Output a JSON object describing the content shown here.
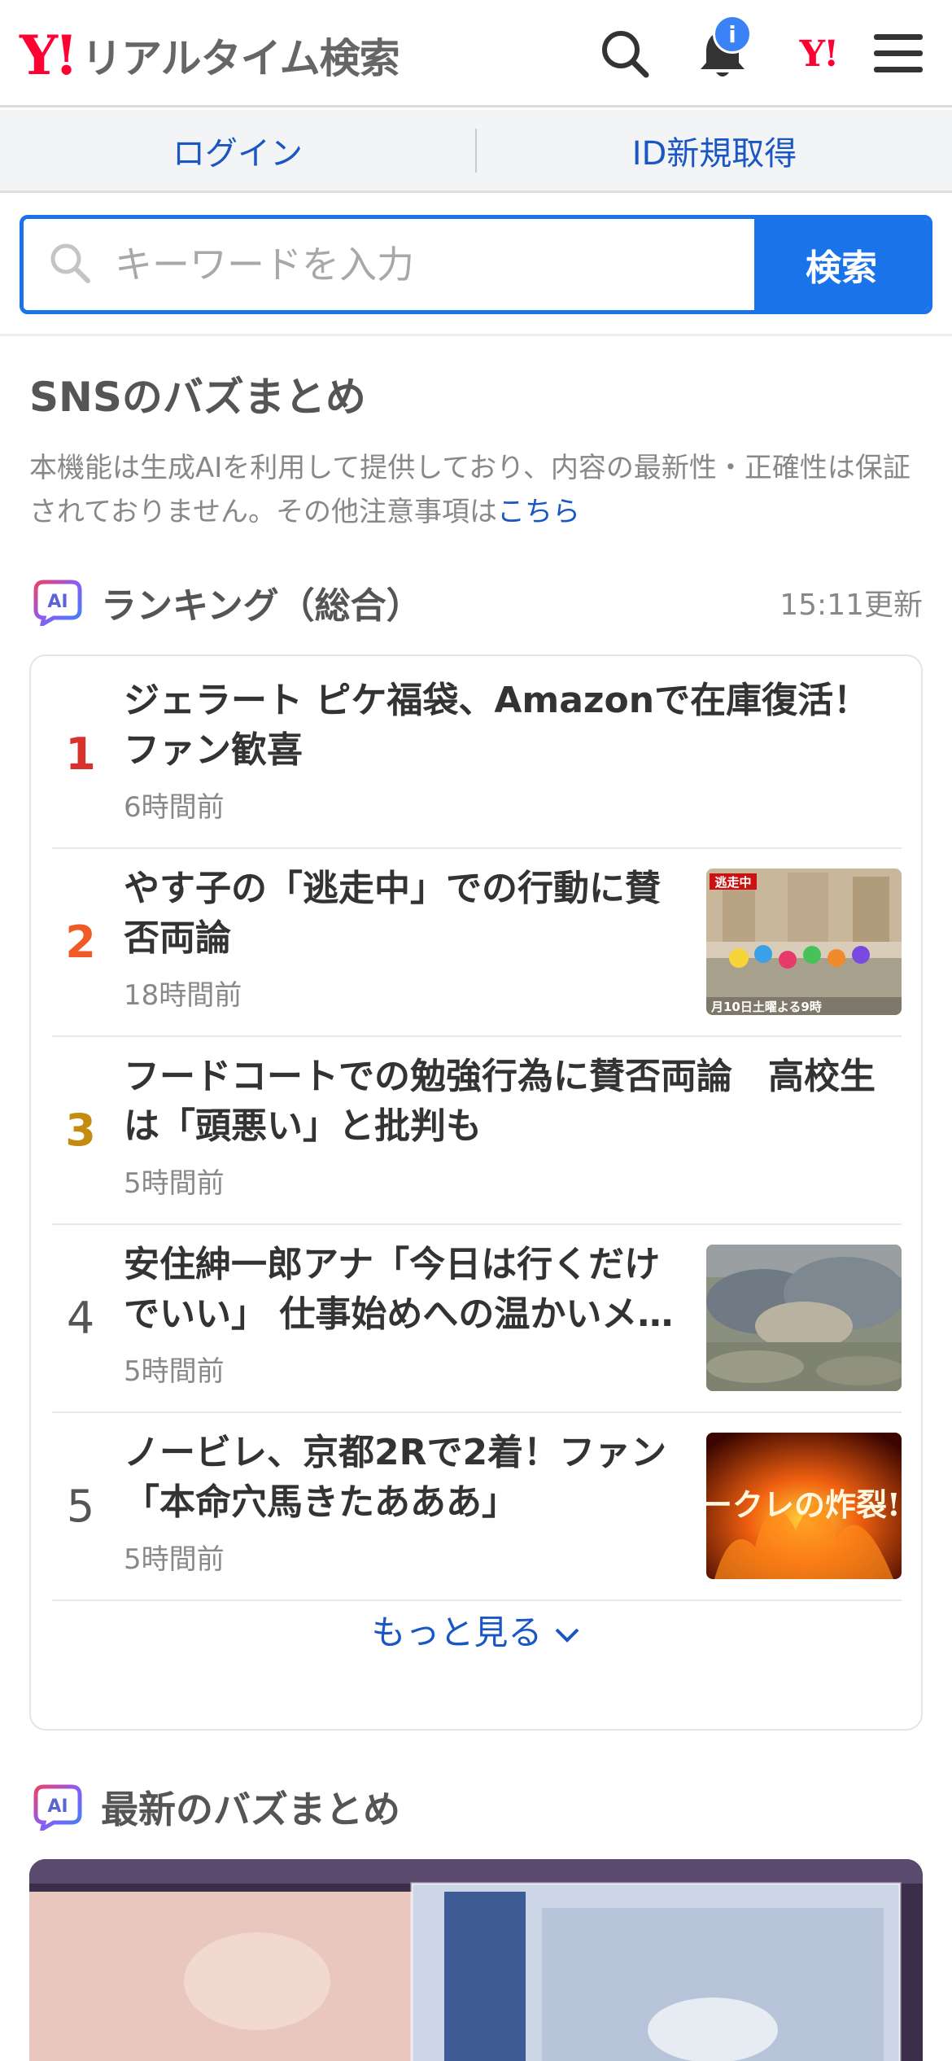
{
  "header": {
    "logo_mark": "Y!",
    "title": "リアルタイム検索",
    "badge": "i",
    "yahoo_mark": "Y!"
  },
  "auth": {
    "login": "ログイン",
    "signup": "ID新規取得"
  },
  "search": {
    "placeholder": "キーワードを入力",
    "button": "検索"
  },
  "section": {
    "title": "SNSのバズまとめ",
    "notice": "本機能は生成AIを利用して提供しており、内容の最新性・正確性は保証されておりません。その他注意事項は",
    "notice_link": "こちら"
  },
  "ranking": {
    "ai_label": "AI",
    "title": "ランキング（総合）",
    "updated": "15:11更新",
    "more": "もっと見る",
    "items": [
      {
        "rank": "1",
        "title": "ジェラート ピケ福袋、Amazonで在庫復活！ファン歓喜",
        "time": "6時間前"
      },
      {
        "rank": "2",
        "title": "やす子の「逃走中」での行動に賛否両論",
        "time": "18時間前",
        "thumb_caption": "月10日土曜よる9時",
        "thumb_logo": "逃走中"
      },
      {
        "rank": "3",
        "title": "フードコートでの勉強行為に賛否両論　高校生は「頭悪い」と批判も",
        "time": "5時間前"
      },
      {
        "rank": "4",
        "title": "安住紳一郎アナ「今日は行くだけでいい」 仕事始めへの温かいメ…",
        "time": "5時間前"
      },
      {
        "rank": "5",
        "title": "ノービレ、京都2Rで2着！ファン「本命穴馬きたあああ」",
        "time": "5時間前",
        "thumb_caption": "ークレの炸裂!"
      }
    ]
  },
  "latest": {
    "ai_label": "AI",
    "title": "最新のバズまとめ"
  },
  "colors": {
    "brand_red": "#ff0033",
    "link_blue": "#1a56c4",
    "accent_blue": "#1a73e8",
    "rank1": "#d8322b",
    "rank2": "#f05a24",
    "rank3": "#c58a10"
  }
}
